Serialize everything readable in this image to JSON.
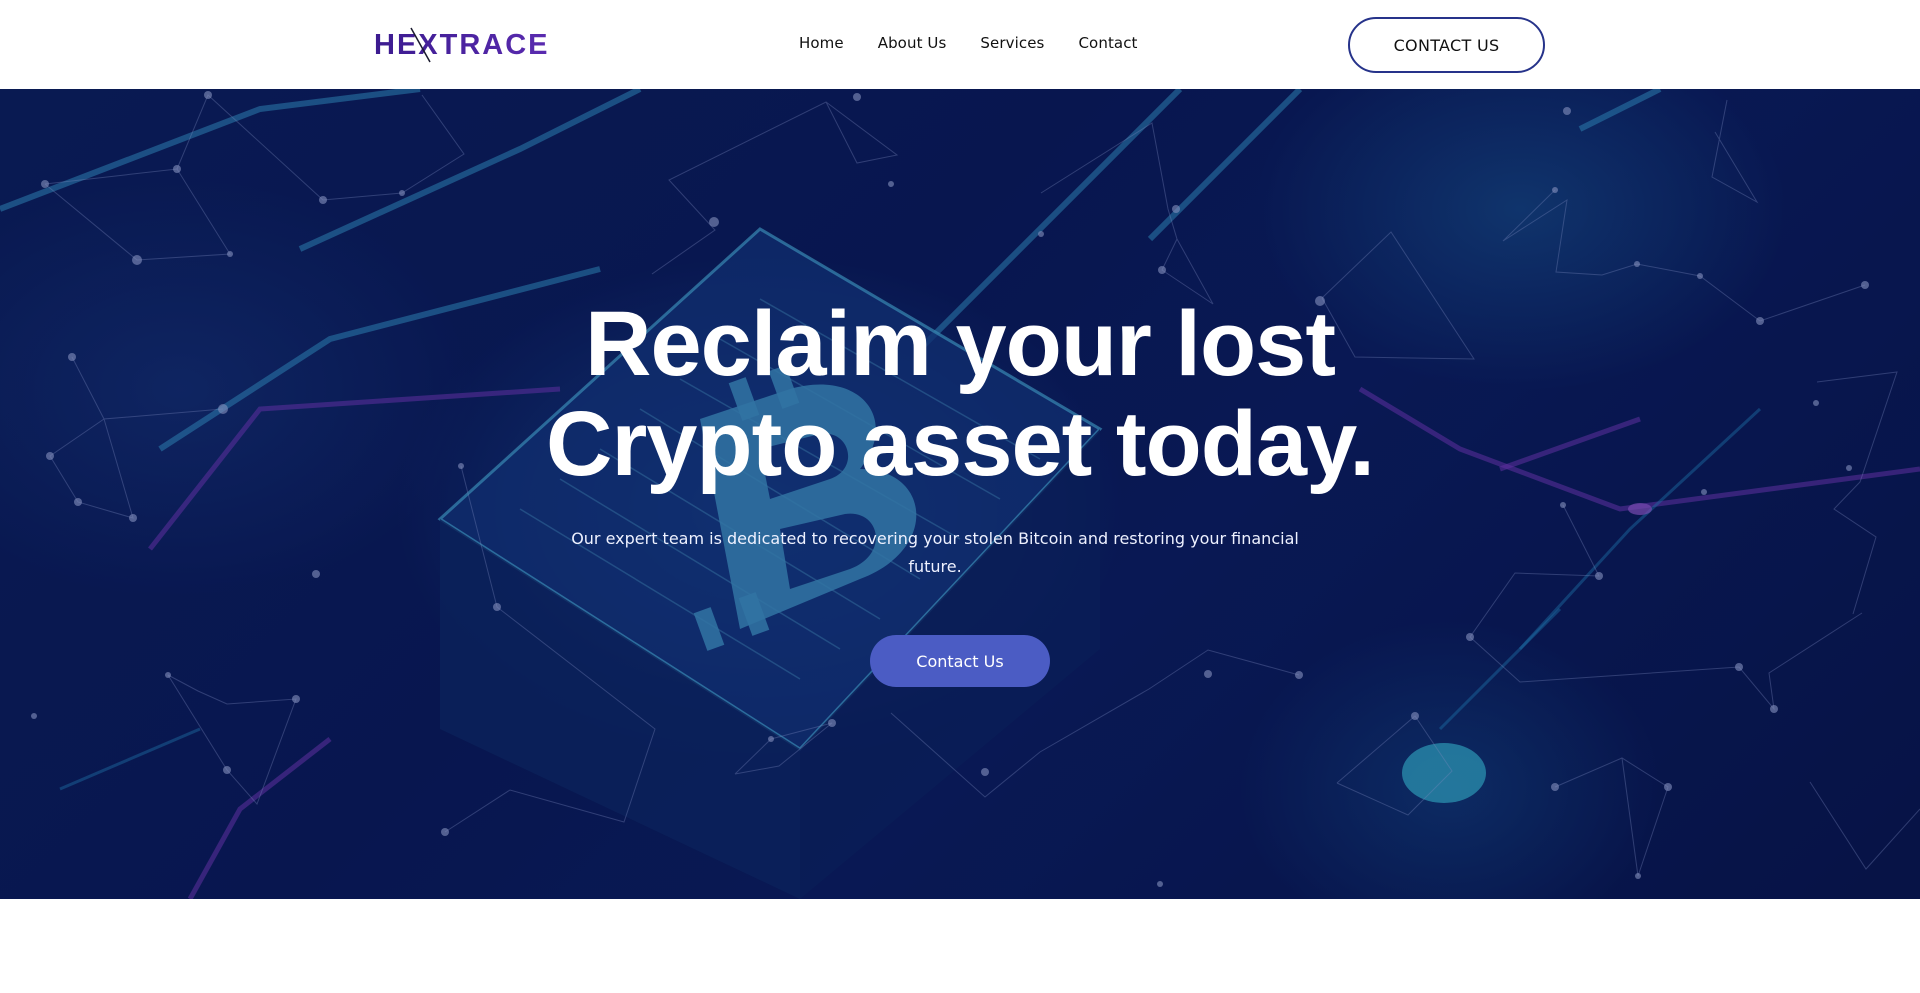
{
  "header": {
    "logo_text": "HEXTRACE",
    "nav": [
      {
        "label": "Home"
      },
      {
        "label": "About Us"
      },
      {
        "label": "Services"
      },
      {
        "label": "Contact"
      }
    ],
    "cta_label": "CONTACT US"
  },
  "hero": {
    "title_line1": "Reclaim your lost",
    "title_line2": "Crypto asset today.",
    "subtitle": "Our expert team is dedicated to recovering your stolen Bitcoin and restoring your financial future.",
    "button_label": "Contact Us"
  },
  "colors": {
    "brand_purple": "#4a1f9e",
    "header_button_border": "#26338a",
    "hero_button": "#4b5cc4",
    "hero_background": "#0b1d5c"
  }
}
